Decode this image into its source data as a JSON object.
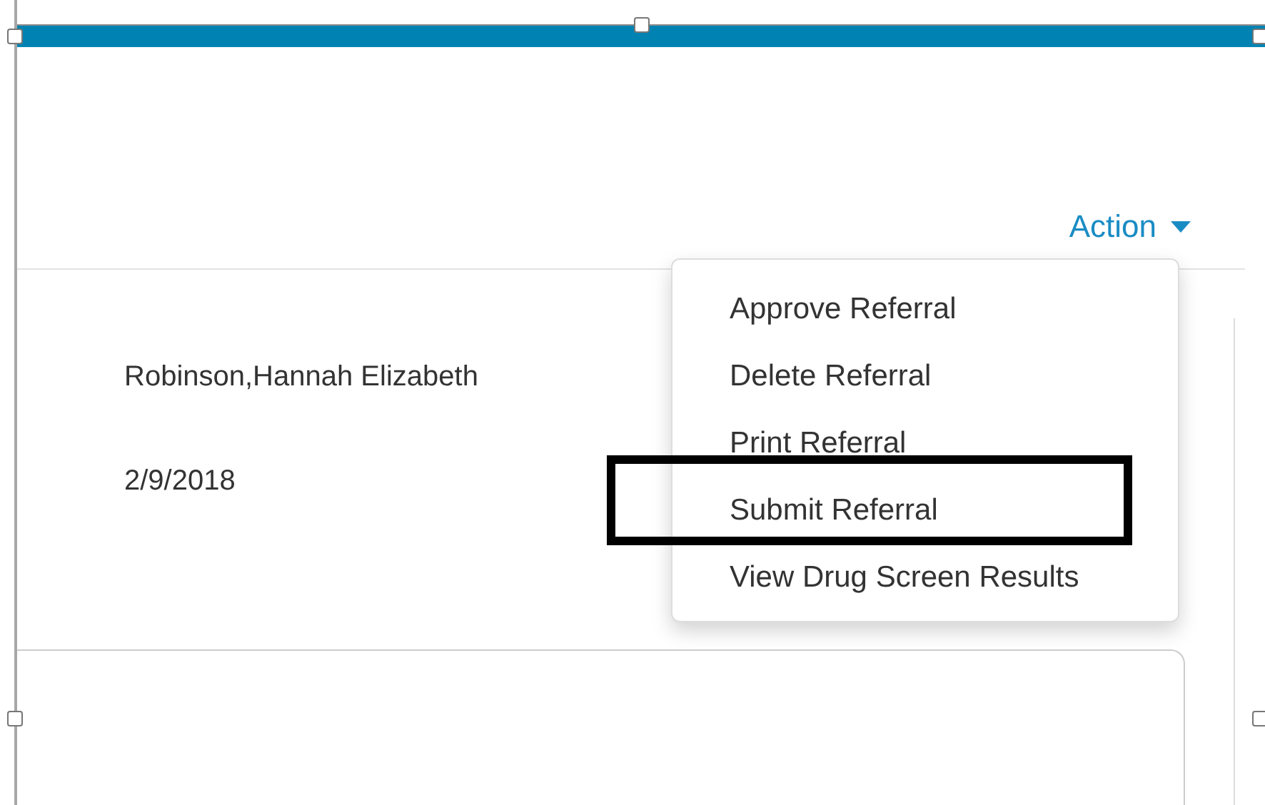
{
  "header": {
    "action_button": {
      "label": "Action",
      "expanded": true
    }
  },
  "action_menu": {
    "items": [
      {
        "label": "Approve Referral",
        "highlighted": false
      },
      {
        "label": "Delete Referral",
        "highlighted": false
      },
      {
        "label": "Print Referral",
        "highlighted": false
      },
      {
        "label": "Submit Referral",
        "highlighted": true
      },
      {
        "label": "View Drug Screen Results",
        "highlighted": false
      }
    ]
  },
  "referral": {
    "name": "Robinson,Hannah Elizabeth",
    "date": "2/9/2018"
  }
}
